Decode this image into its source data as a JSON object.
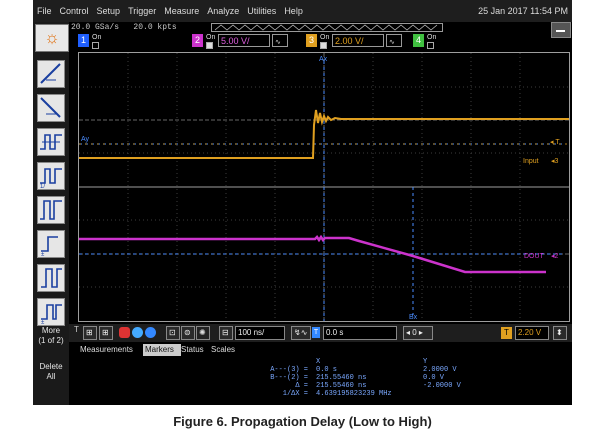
{
  "menu": {
    "items": [
      "File",
      "Control",
      "Setup",
      "Trigger",
      "Measure",
      "Analyze",
      "Utilities",
      "Help"
    ],
    "datetime": "25 Jan 2017 11:54 PM"
  },
  "acquisition": {
    "sample_rate": "20.0 GSa/s",
    "memory_depth": "20.0 kpts"
  },
  "channels": [
    {
      "number": "1",
      "state": "On",
      "scale": "",
      "color": "#2060ff"
    },
    {
      "number": "2",
      "state": "On",
      "scale": "5.00 V/",
      "color": "#cc33cc"
    },
    {
      "number": "3",
      "state": "On",
      "scale": "2.00 V/",
      "color": "#e0a020"
    },
    {
      "number": "4",
      "state": "On",
      "scale": "",
      "color": "#40c040"
    }
  ],
  "sidebar": {
    "icons": [
      "rising-edge-trigger-icon",
      "falling-edge-trigger-icon",
      "pulse-width-trigger-icon",
      "runt-trigger-icon",
      "setup-hold-trigger-icon",
      "transition-trigger-icon",
      "window-trigger-icon",
      "pattern-trigger-icon"
    ],
    "more_label": "More",
    "more_page": "(1 of 2)",
    "delete_label": "Delete",
    "delete_all": "All"
  },
  "waveform": {
    "ay_label": "Ay",
    "ax_label": "Ax",
    "bx_label": "Bx",
    "t_label": "T",
    "input_label": "Input",
    "input_channel": "3",
    "dout_label": "DOUT",
    "dout_channel": "2",
    "colors": {
      "input": "#e0a020",
      "dout": "#cc33cc",
      "marker": "#4a8cff"
    }
  },
  "timebase": {
    "scale": "100 ns/",
    "delay": "0.0 s",
    "trigger_channel": "T",
    "trigger_level": "2.20 V"
  },
  "tabs": [
    "Measurements",
    "Markers",
    "Status",
    "Scales"
  ],
  "active_tab": "Markers",
  "markers": {
    "header_x": "X",
    "header_y": "Y",
    "rows": [
      {
        "label": "A---(3) =",
        "x": "0.0 s",
        "y": "2.0000 V"
      },
      {
        "label": "B---(2) =",
        "x": "215.55460 ns",
        "y": "0.0 V"
      },
      {
        "label": "Δ =",
        "x": "215.55460 ns",
        "y": "-2.0000 V"
      },
      {
        "label": "1/ΔX =",
        "x": "4.639195823239 MHz",
        "y": ""
      }
    ]
  },
  "caption": "Figure 6. Propagation Delay (Low to High)"
}
